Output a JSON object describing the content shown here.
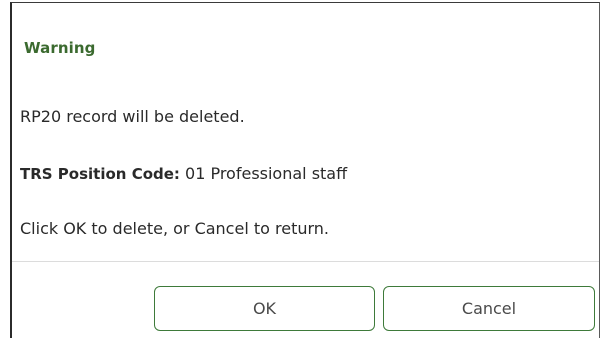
{
  "dialog": {
    "title": "Warning",
    "message": "RP20 record will be deleted.",
    "field": {
      "label": "TRS Position Code:",
      "value": " 01 Professional staff"
    },
    "instruction": "Click OK to delete, or Cancel to return.",
    "buttons": {
      "ok_label": "OK",
      "cancel_label": "Cancel"
    }
  },
  "colors": {
    "title": "#3b6a2f",
    "button_border": "#3e7a3a",
    "text": "#2a2a2a"
  }
}
